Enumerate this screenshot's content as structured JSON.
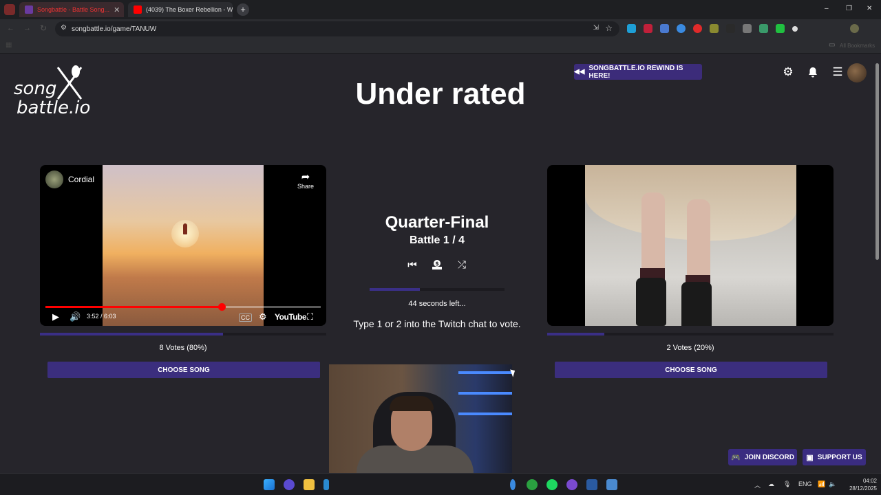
{
  "browser": {
    "tabs": [
      {
        "title": "Songbattle - Battle Song...",
        "active": true
      },
      {
        "title": "(4039) The Boxer Rebellion - W",
        "active": false
      }
    ],
    "new_tab": "+",
    "url": "songbattle.io/game/TANUW",
    "bookmarks_label": "All Bookmarks",
    "window_controls": {
      "minimize": "–",
      "maximize": "❐",
      "close": "✕"
    }
  },
  "header": {
    "logo_line1": "song",
    "logo_line2": "battle.io",
    "title": "Under rated",
    "rewind_label": "SONGBATTLE.IO REWIND IS HERE!",
    "icons": [
      "settings-icon",
      "bell-icon",
      "menu-icon"
    ]
  },
  "left_song": {
    "channel_name": "Cordial",
    "share_label": "Share",
    "time": "3:52 / 6:03",
    "progress": 0.64,
    "player_brand": "YouTube",
    "votes_label": "8 Votes (80%)",
    "vote_fraction": 0.8,
    "choose_label": "CHOOSE SONG"
  },
  "right_song": {
    "votes_label": "2 Votes (20%)",
    "vote_fraction": 0.2,
    "choose_label": "CHOOSE SONG"
  },
  "battle": {
    "stage": "Quarter-Final",
    "progress_label": "Battle 1 / 4",
    "timer_fraction": 0.37,
    "seconds_left": "44 seconds left...",
    "instructions": "Type 1 or 2 into the Twitch chat to vote."
  },
  "footer": {
    "discord_label": "JOIN DISCORD",
    "support_label": "SUPPORT US"
  },
  "taskbar": {
    "language": "ENG",
    "time": "04:02",
    "date": "28/12/2025"
  },
  "colors": {
    "accent": "#3b2e7e",
    "background": "#26252b",
    "youtube_red": "#ff0000"
  }
}
